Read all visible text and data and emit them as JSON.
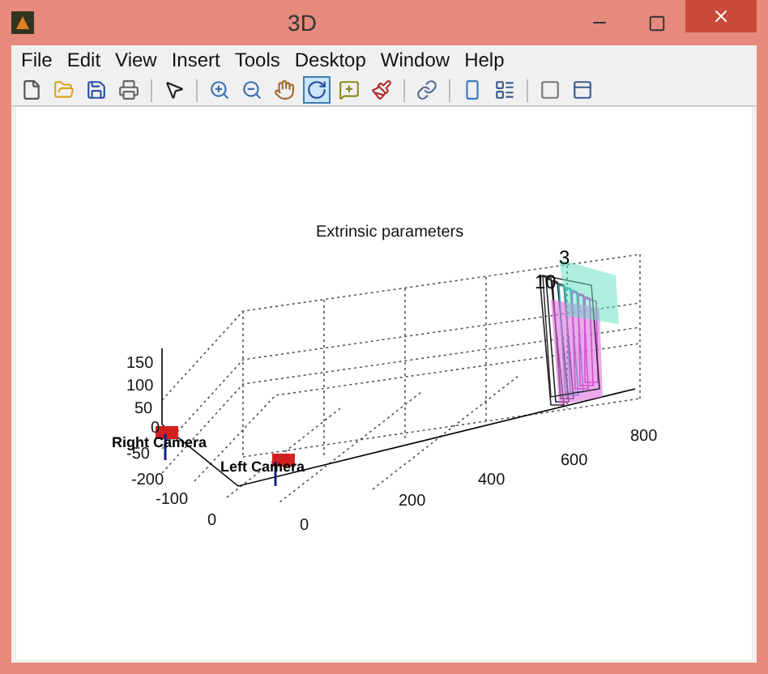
{
  "window": {
    "title": "3D"
  },
  "menu": [
    "File",
    "Edit",
    "View",
    "Insert",
    "Tools",
    "Desktop",
    "Window",
    "Help"
  ],
  "toolbar": [
    {
      "kind": "new",
      "selected": false
    },
    {
      "kind": "open",
      "selected": false
    },
    {
      "kind": "save",
      "selected": false
    },
    {
      "kind": "print",
      "selected": false
    },
    {
      "kind": "sep"
    },
    {
      "kind": "pointer",
      "selected": false
    },
    {
      "kind": "sep"
    },
    {
      "kind": "zoom-in",
      "selected": false
    },
    {
      "kind": "zoom-out",
      "selected": false
    },
    {
      "kind": "pan",
      "selected": false
    },
    {
      "kind": "rotate",
      "selected": true
    },
    {
      "kind": "cursor",
      "selected": false
    },
    {
      "kind": "brush",
      "selected": false
    },
    {
      "kind": "sep"
    },
    {
      "kind": "link",
      "selected": false
    },
    {
      "kind": "sep"
    },
    {
      "kind": "colorbar",
      "selected": false
    },
    {
      "kind": "legend",
      "selected": false
    },
    {
      "kind": "sep"
    },
    {
      "kind": "hide",
      "selected": false
    },
    {
      "kind": "show",
      "selected": false
    }
  ],
  "plot": {
    "title": "Extrinsic parameters",
    "z_ticks": [
      "150",
      "100",
      "50",
      "0",
      "-50"
    ],
    "y_ticks": [
      "-200",
      "-100",
      "0"
    ],
    "x_ticks": [
      "0",
      "200",
      "400",
      "600",
      "800"
    ],
    "labels": [
      {
        "kind": "camera",
        "text": "Right Camera"
      },
      {
        "kind": "camera",
        "text": "Left Camera"
      },
      {
        "kind": "index",
        "text": "10"
      },
      {
        "kind": "index",
        "text": "3"
      }
    ]
  }
}
